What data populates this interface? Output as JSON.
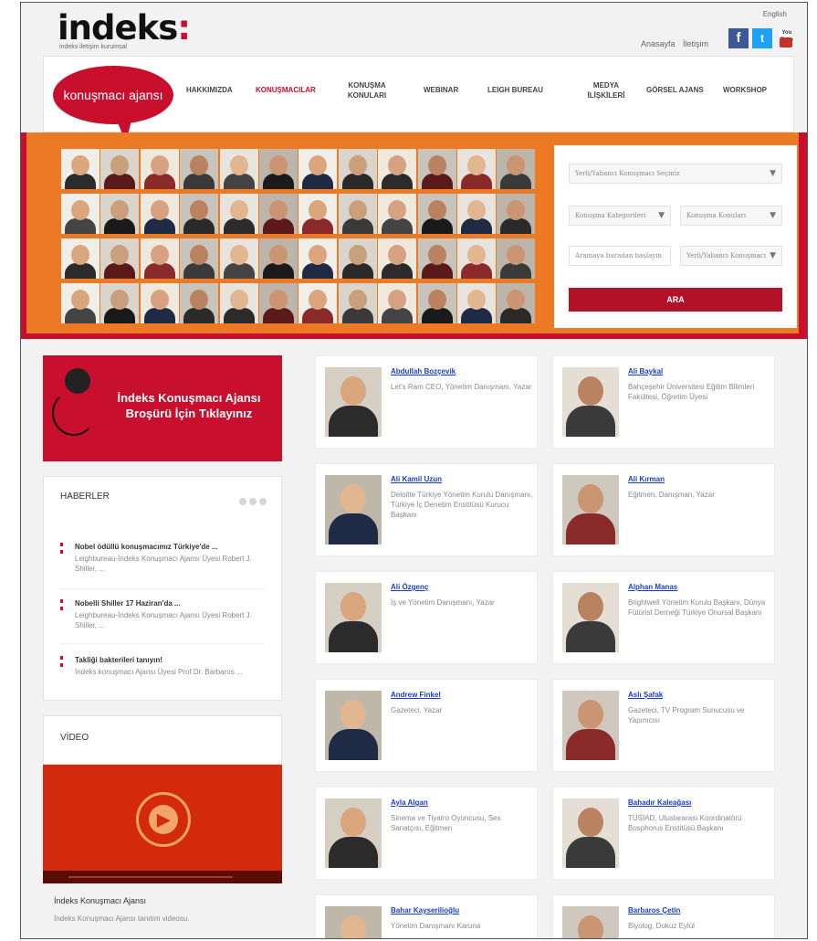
{
  "header": {
    "logo_text": "indeks",
    "logo_colon": ":",
    "tagline": "indeks iletişim kurumsal",
    "language_link": "English",
    "links": [
      "Anasayfa",
      "İletişim"
    ],
    "social": {
      "facebook": "f",
      "twitter": "t",
      "youtube": "You Tube"
    }
  },
  "nav": {
    "brand": "konuşmacı ajansı",
    "items": [
      {
        "label": "HAKKIMIZDA"
      },
      {
        "label": "KONUŞMACILAR"
      },
      {
        "label": "KONUŞMA KONULARI"
      },
      {
        "label": "WEBINAR"
      },
      {
        "label": "LEIGH BUREAU"
      },
      {
        "label": "MEDYA İLİŞKİLERİ"
      },
      {
        "label": "GÖRSEL AJANS"
      },
      {
        "label": "WORKSHOP"
      }
    ],
    "active_index": 1
  },
  "search": {
    "select_speaker": "Yerli/Yabancı Konuşmacı Seçiniz",
    "select_category": "Konuşma Kategorileri",
    "select_topic": "Konuşma Konuları",
    "input_placeholder": "Aramaya buradan başlayın",
    "select_type": "Yerli/Yabancı Konuşmacı",
    "button": "ARA"
  },
  "brochure": {
    "line1": "İndeks Konuşmacı Ajansı",
    "line2": "Broşürü İçin Tıklayınız"
  },
  "news": {
    "title": "HABERLER",
    "items": [
      {
        "title": "Nobel ödüllü konuşmacımız Türkiye'de ...",
        "text": "Leighbureau-İndeks Konuşmacı Ajansı Üyesi Robert J. Shiller, ..."
      },
      {
        "title": "Nobelli Shiller 17 Haziran'da ...",
        "text": "Leighbureau-İndeks Konuşmacı Ajansı Üyesi Robert J. Shiller, ..."
      },
      {
        "title": "Takliği bakterileri tanıyın!",
        "text": "İndeks konuşmacı Ajansı Üyesi Prof Dr. Barbaros ..."
      }
    ]
  },
  "video": {
    "title": "VİDEO",
    "caption_title": "İndeks Konuşmacı Ajansı",
    "caption_text": "İndeks Konuşmacı Ajansı tanıtım videosu."
  },
  "speakers": [
    {
      "name": "Abdullah Bozçevik",
      "desc": "Let's Ram CEO, Yönetim Danışmanı, Yazar"
    },
    {
      "name": "Ali Baykal",
      "desc": "Bahçeşehir Üniversitesi Eğitim Bilimleri Fakültesi, Öğretim Üyesi"
    },
    {
      "name": "Ali Kamil Uzun",
      "desc": "Deloitte Türkiye Yönetim Kurulu Danışmanı, Türkiye İç Denetim Enstitüsü Kurucu Başkanı"
    },
    {
      "name": "Ali Kırman",
      "desc": "Eğitmen, Danışman, Yazar"
    },
    {
      "name": "Ali Özgenç",
      "desc": "İş ve Yönetim Danışmanı, Yazar"
    },
    {
      "name": "Alphan Manas",
      "desc": "Brightwell Yönetim Kurulu Başkanı, Dünya Fütürist Derneği Türkiye Onursal Başkanı"
    },
    {
      "name": "Andrew Finkel",
      "desc": "Gazeteci, Yazar"
    },
    {
      "name": "Aslı Şafak",
      "desc": "Gazeteci, TV Program Sunucusu ve Yapımcısı"
    },
    {
      "name": "Ayla Algan",
      "desc": "Sinema ve Tiyatro Oyuncusu, Ses Sanatçısı, Eğitmen"
    },
    {
      "name": "Bahadır Kaleağası",
      "desc": "TÜSİAD, Uluslararası Koordinatörü Bosphorus Enstitüsü Başkanı"
    },
    {
      "name": "Bahar Kayserilioğlu",
      "desc": "Yönetim Danışmanı Karuna"
    },
    {
      "name": "Barbaros Çetin",
      "desc": "Biyolog, Dokuz Eylül"
    }
  ]
}
